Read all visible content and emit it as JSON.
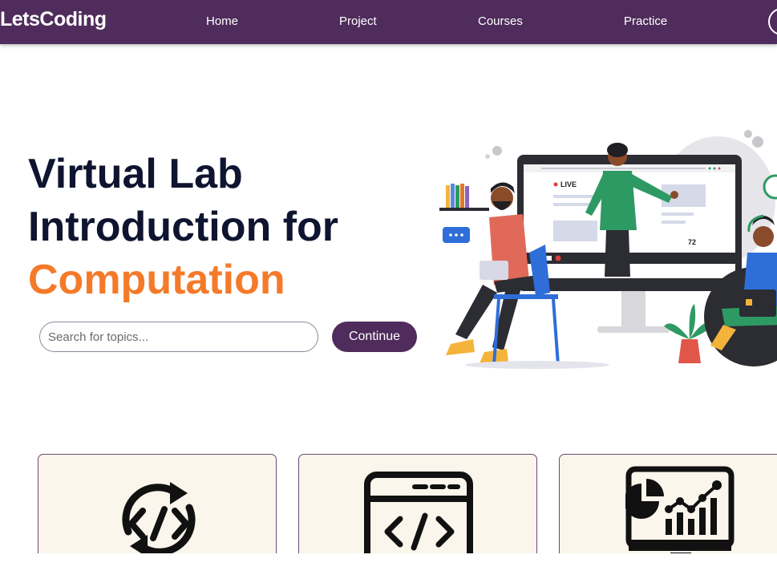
{
  "nav": {
    "brand": "LetsCoding",
    "links": [
      "Home",
      "Project",
      "Courses",
      "Practice"
    ]
  },
  "hero": {
    "title_line1": "Virtual Lab",
    "title_line2": "Introduction for",
    "title_accent": "Computation",
    "search_placeholder": "Search for topics...",
    "continue_label": "Continue",
    "illustration": {
      "live_badge": "LIVE",
      "viewer_count": "72"
    }
  },
  "cards": [
    {
      "icon": "code-cycle-icon"
    },
    {
      "icon": "browser-code-icon"
    },
    {
      "icon": "analytics-monitor-icon"
    }
  ],
  "colors": {
    "nav_bg": "#4f2c5c",
    "accent_orange": "#f47a2a",
    "title_dark": "#0f1530",
    "card_bg": "#faf6ec"
  }
}
